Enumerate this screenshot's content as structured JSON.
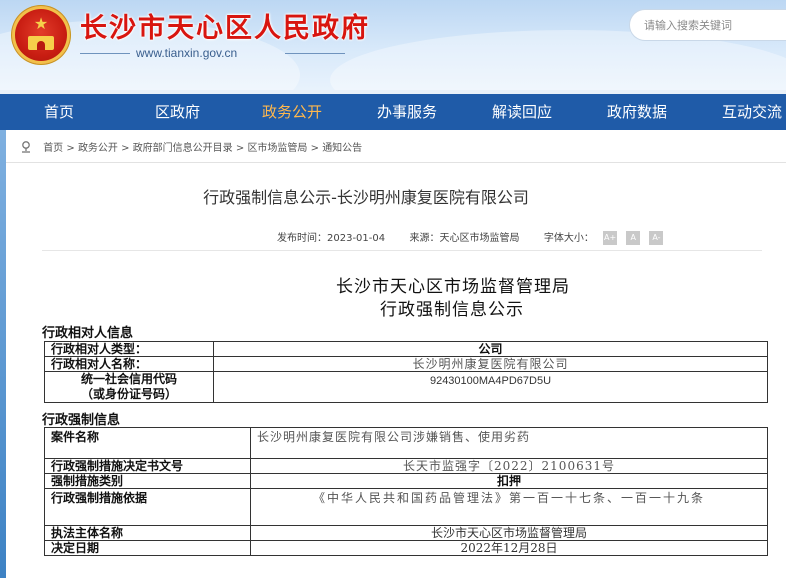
{
  "header": {
    "site_title": "长沙市天心区人民政府",
    "site_url": "www.tianxin.gov.cn",
    "search_placeholder": "请输入搜索关键词"
  },
  "nav": {
    "items": [
      "首页",
      "区政府",
      "政务公开",
      "办事服务",
      "解读回应",
      "政府数据",
      "互动交流"
    ],
    "active": "政务公开"
  },
  "breadcrumb": [
    "首页",
    "政务公开",
    "政府部门信息公开目录",
    "区市场监管局",
    "通知公告"
  ],
  "article": {
    "title": "行政强制信息公示-长沙明州康复医院有限公司",
    "publish_label": "发布时间：",
    "publish_date": "2023-01-04",
    "source_label": "来源：",
    "source": "天心区市场监管局",
    "fontsize_label": "字体大小：",
    "font_buttons": [
      "A+",
      "A",
      "A-"
    ]
  },
  "document": {
    "org": "长沙市天心区市场监督管理局",
    "title": "行政强制信息公示",
    "section1_title": "行政相对人信息",
    "section1_rows": [
      {
        "label": "行政相对人类型：",
        "value": "公司"
      },
      {
        "label": "行政相对人名称：",
        "value": "长沙明州康复医院有限公司"
      },
      {
        "label": "统一社会信用代码",
        "label2": "（或身份证号码）",
        "value": "92430100MA4PD67D5U"
      }
    ],
    "section2_title": "行政强制信息",
    "section2_rows": [
      {
        "label": "案件名称",
        "value": "长沙明州康复医院有限公司涉嫌销售、使用劣药"
      },
      {
        "label": "行政强制措施决定书文号",
        "value": "长天市监强字〔2022〕2100631号"
      },
      {
        "label": "强制措施类别",
        "value": "扣押"
      },
      {
        "label": "行政强制措施依据",
        "value": "《中华人民共和国药品管理法》第一百一十七条、一百一十九条"
      },
      {
        "label": "执法主体名称",
        "value": "长沙市天心区市场监督管理局"
      },
      {
        "label": "决定日期",
        "value": "2022年12月28日"
      }
    ]
  },
  "colors": {
    "nav_bg": "#1f5ba8",
    "nav_active": "#ffb84d",
    "title_red": "#d8150f"
  },
  "icons": {
    "emblem": "national-emblem-icon",
    "breadcrumb": "location-pin-icon"
  }
}
